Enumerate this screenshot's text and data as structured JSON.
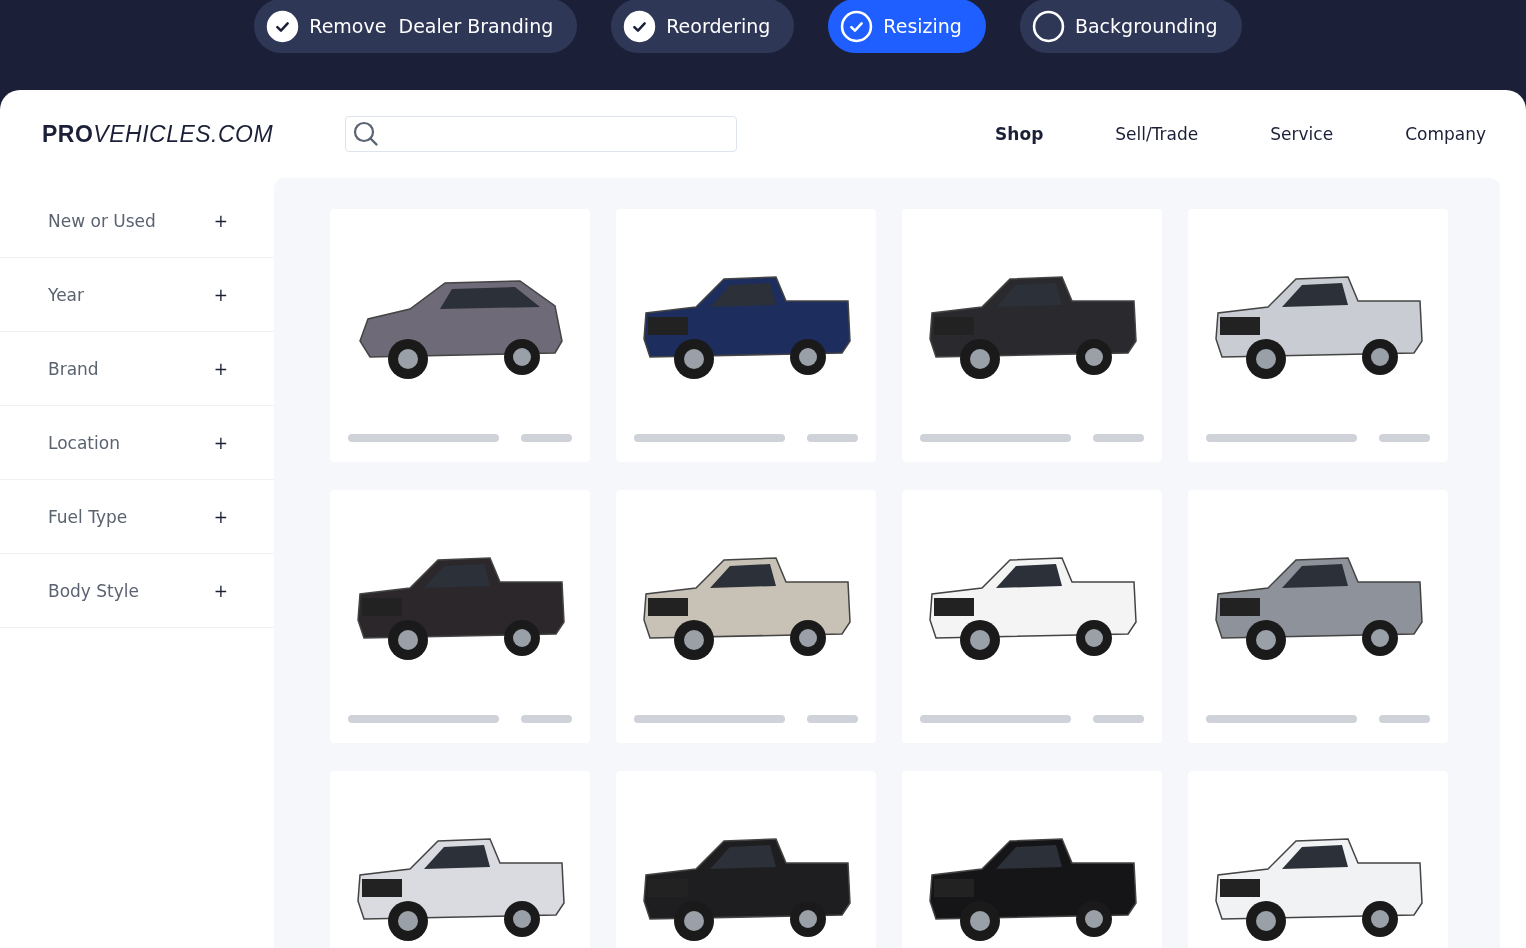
{
  "steps": [
    {
      "label": "Remove  Dealer Branding",
      "checked": true,
      "selected": false
    },
    {
      "label": "Reordering",
      "checked": true,
      "selected": false
    },
    {
      "label": "Resizing",
      "checked": true,
      "selected": true
    },
    {
      "label": "Backgrounding",
      "checked": false,
      "selected": false
    }
  ],
  "logo": {
    "strong": "PRO",
    "light": "VEHICLES.COM"
  },
  "nav": [
    {
      "label": "Shop",
      "selected": true
    },
    {
      "label": "Sell/Trade",
      "selected": false
    },
    {
      "label": "Service",
      "selected": false
    },
    {
      "label": "Company",
      "selected": false
    }
  ],
  "filters": [
    {
      "label": "New or Used",
      "toggle": "+"
    },
    {
      "label": "Year",
      "toggle": "+"
    },
    {
      "label": "Brand",
      "toggle": "+"
    },
    {
      "label": "Location",
      "toggle": "+"
    },
    {
      "label": "Fuel Type",
      "toggle": "+"
    },
    {
      "label": "Body Style",
      "toggle": "+"
    }
  ],
  "vehicles": [
    {
      "kind": "suv",
      "color": "#6e6a78"
    },
    {
      "kind": "truck",
      "color": "#1c2d5e"
    },
    {
      "kind": "truck",
      "color": "#2a2a2e"
    },
    {
      "kind": "truck",
      "color": "#c9ccd2"
    },
    {
      "kind": "truck",
      "color": "#2b272b"
    },
    {
      "kind": "truck",
      "color": "#c8c2b6"
    },
    {
      "kind": "truck",
      "color": "#f4f4f4"
    },
    {
      "kind": "truck",
      "color": "#8e939b"
    },
    {
      "kind": "truck",
      "color": "#d9dbe0"
    },
    {
      "kind": "truck",
      "color": "#1e1e20"
    },
    {
      "kind": "truck",
      "color": "#151517"
    },
    {
      "kind": "truck",
      "color": "#f1f2f4"
    }
  ]
}
